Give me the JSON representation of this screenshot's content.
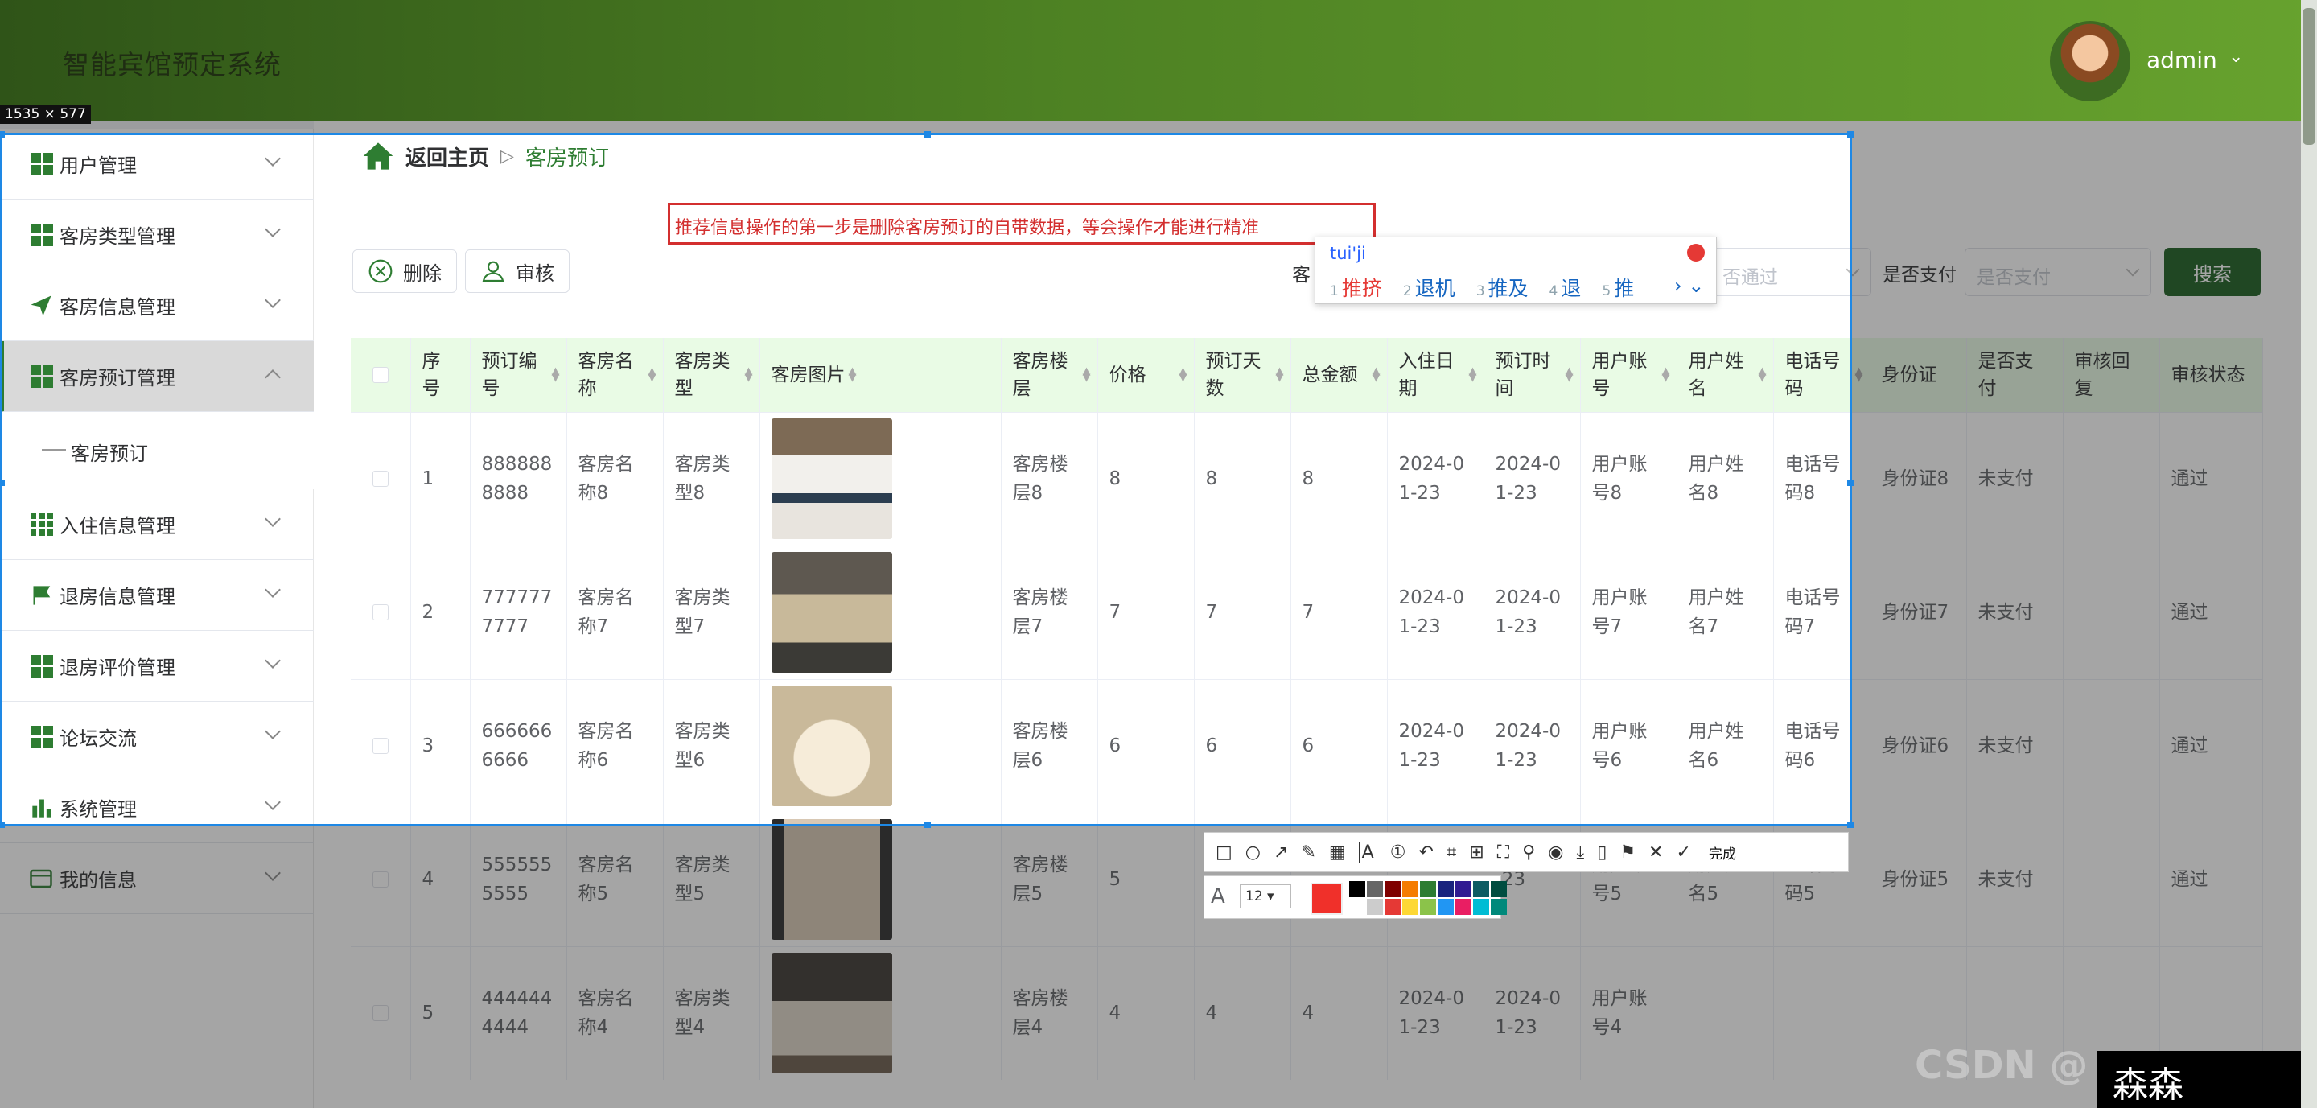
{
  "app": {
    "title": "智能宾馆预定系统",
    "user": "admin",
    "size_badge": "1535 × 577"
  },
  "sidebar": {
    "items": [
      {
        "label": "用户管理",
        "icon": "grid-icon"
      },
      {
        "label": "客房类型管理",
        "icon": "grid-icon"
      },
      {
        "label": "客房信息管理",
        "icon": "send-icon"
      },
      {
        "label": "客房预订管理",
        "icon": "grid-icon",
        "expanded": true
      },
      {
        "label": "入住信息管理",
        "icon": "grid9-icon"
      },
      {
        "label": "退房信息管理",
        "icon": "flag-icon"
      },
      {
        "label": "退房评价管理",
        "icon": "grid-icon"
      },
      {
        "label": "论坛交流",
        "icon": "grid-icon"
      },
      {
        "label": "系统管理",
        "icon": "bar-chart-icon"
      },
      {
        "label": "我的信息",
        "icon": "card-icon"
      }
    ],
    "sub_item": "客房预订"
  },
  "breadcrumb": {
    "home": "返回主页",
    "sep": "▷",
    "current": "客房预订"
  },
  "notice": "推荐信息操作的第一步是删除客房预订的自带数据，等会操作才能进行精准",
  "toolbar": {
    "delete_label": "删除",
    "audit_label": "审核"
  },
  "search": {
    "status_prefix": "客",
    "status_placeholder": "否通过",
    "pay_label": "是否支付",
    "pay_placeholder": "是否支付",
    "button": "搜索"
  },
  "table": {
    "headers": [
      "序号",
      "预订编号",
      "客房名称",
      "客房类型",
      "客房图片",
      "客房楼层",
      "价格",
      "预订天数",
      "总金额",
      "入住日期",
      "预订时间",
      "用户账号",
      "用户姓名",
      "电话号码",
      "身份证",
      "是否支付",
      "审核回复",
      "审核状态"
    ],
    "rows": [
      {
        "idx": "1",
        "code": "8888888888",
        "name": "客房名称8",
        "type": "客房类型8",
        "floor": "客房楼层8",
        "price": "8",
        "days": "8",
        "total": "8",
        "checkin": "2024-01-23",
        "booked": "2024-01-23",
        "account": "用户账号8",
        "uname": "用户姓名8",
        "phone": "电话号码8",
        "idcard": "身份证8",
        "paid": "未支付",
        "reply": "",
        "status": "通过"
      },
      {
        "idx": "2",
        "code": "7777777777",
        "name": "客房名称7",
        "type": "客房类型7",
        "floor": "客房楼层7",
        "price": "7",
        "days": "7",
        "total": "7",
        "checkin": "2024-01-23",
        "booked": "2024-01-23",
        "account": "用户账号7",
        "uname": "用户姓名7",
        "phone": "电话号码7",
        "idcard": "身份证7",
        "paid": "未支付",
        "reply": "",
        "status": "通过"
      },
      {
        "idx": "3",
        "code": "6666666666",
        "name": "客房名称6",
        "type": "客房类型6",
        "floor": "客房楼层6",
        "price": "6",
        "days": "6",
        "total": "6",
        "checkin": "2024-01-23",
        "booked": "2024-01-23",
        "account": "用户账号6",
        "uname": "用户姓名6",
        "phone": "电话号码6",
        "idcard": "身份证6",
        "paid": "未支付",
        "reply": "",
        "status": "通过"
      },
      {
        "idx": "4",
        "code": "5555555555",
        "name": "客房名称5",
        "type": "客房类型5",
        "floor": "客房楼层5",
        "price": "5",
        "days": "",
        "total": "",
        "checkin": "",
        "booked": "-23",
        "account": "用户账号5",
        "uname": "用户姓名5",
        "phone": "电话号码5",
        "idcard": "身份证5",
        "paid": "未支付",
        "reply": "",
        "status": "通过"
      },
      {
        "idx": "5",
        "code": "4444444444",
        "name": "客房名称4",
        "type": "客房类型4",
        "floor": "客房楼层4",
        "price": "4",
        "days": "4",
        "total": "4",
        "checkin": "2024-01-23",
        "booked": "2024-01-23",
        "account": "用户账号4",
        "uname": "",
        "phone": "",
        "idcard": "",
        "paid": "",
        "reply": "",
        "status": ""
      }
    ]
  },
  "ime": {
    "input": "tui'ji",
    "candidates": [
      {
        "n": "1",
        "t": "推挤"
      },
      {
        "n": "2",
        "t": "退机"
      },
      {
        "n": "3",
        "t": "推及"
      },
      {
        "n": "4",
        "t": "退"
      },
      {
        "n": "5",
        "t": "推"
      }
    ],
    "next": "› ⌄"
  },
  "annot": {
    "done_label": "完成",
    "font_size": "12 ▾",
    "font_glyph": "A"
  },
  "watermark": {
    "text": "森森coding",
    "csdn": "CSDN @"
  },
  "colors": {
    "accent": "#2e7d32",
    "header_dark": "#2f5418",
    "header_light": "#67a22e",
    "table_head": "#e9fbe5",
    "selection": "#1e88e5",
    "notice": "#d32f2f"
  }
}
